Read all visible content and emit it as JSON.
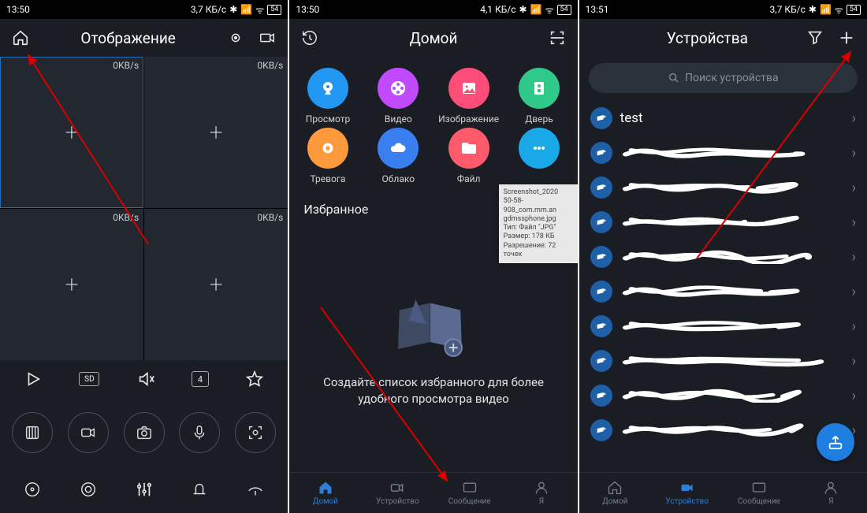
{
  "screen1": {
    "status": {
      "time": "13:50",
      "net": "3,7 КБ/с",
      "battery": "54"
    },
    "title": "Отображение",
    "cells": [
      {
        "rate": "0KB/s"
      },
      {
        "rate": "0KB/s"
      },
      {
        "rate": "0KB/s"
      },
      {
        "rate": "0KB/s"
      }
    ],
    "sd_label": "SD",
    "layout_label": "4"
  },
  "screen2": {
    "status": {
      "time": "13:50",
      "net": "4,1 КБ/с",
      "battery": "54"
    },
    "title": "Домой",
    "apps": [
      {
        "label": "Просмотр",
        "color": "#2196f3"
      },
      {
        "label": "Видео",
        "color": "#c14aff"
      },
      {
        "label": "Изображение",
        "color": "#ff4d7a"
      },
      {
        "label": "Дверь",
        "color": "#2fc98a"
      },
      {
        "label": "Тревога",
        "color": "#ff9a3c"
      },
      {
        "label": "Облако",
        "color": "#3a7ff0"
      },
      {
        "label": "Файл",
        "color": "#ff5a6b"
      },
      {
        "label": "",
        "color": "#1aa9e8"
      }
    ],
    "favorites_title": "Избранное",
    "favorites_text": "Создайте список избранного для более удобного просмотра видео",
    "tooltip": "Screenshot_2020\n50-58-\n908_com.mm.an\ngdmssphone.jpg\nТип: Файл \"JPG\"\nРазмер: 178 КБ\nРазрешение: 72\nточек",
    "nav": [
      {
        "label": "Домой"
      },
      {
        "label": "Устройство"
      },
      {
        "label": "Сообщение"
      },
      {
        "label": "Я"
      }
    ]
  },
  "screen3": {
    "status": {
      "time": "13:51",
      "net": "3,7 КБ/с",
      "battery": "54"
    },
    "title": "Устройства",
    "search_placeholder": "Поиск устройства",
    "devices": [
      {
        "label": "test",
        "redacted": false
      },
      {
        "label": "",
        "redacted": true
      },
      {
        "label": "",
        "redacted": true
      },
      {
        "label": "",
        "redacted": true
      },
      {
        "label": "",
        "redacted": true
      },
      {
        "label": "",
        "redacted": true
      },
      {
        "label": "",
        "redacted": true
      },
      {
        "label": "",
        "redacted": true
      },
      {
        "label": "",
        "redacted": true
      },
      {
        "label": "",
        "redacted": true
      }
    ],
    "nav": [
      {
        "label": "Домой"
      },
      {
        "label": "Устройство"
      },
      {
        "label": "Сообщение"
      },
      {
        "label": "Я"
      }
    ]
  }
}
